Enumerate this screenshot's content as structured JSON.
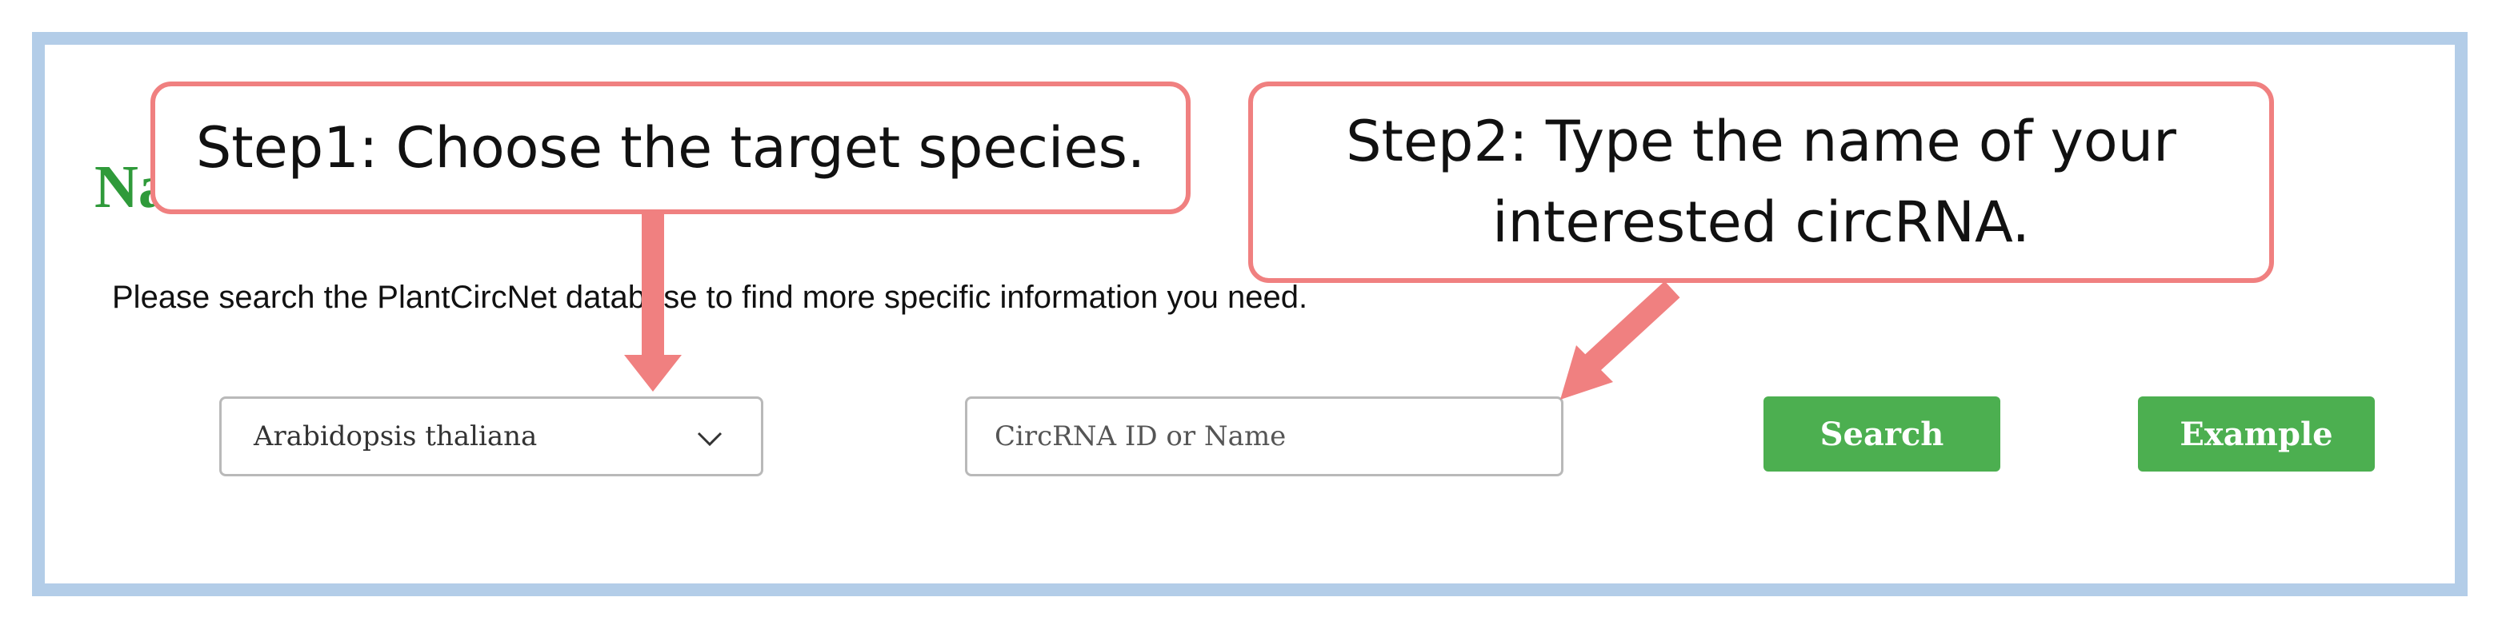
{
  "page": {
    "title": "Name Search",
    "intro": "Please search the PlantCircNet database to find more specific information you need."
  },
  "form": {
    "species_select": {
      "selected": "Arabidopsis thaliana",
      "icon": "chevron-down-icon"
    },
    "query_input": {
      "value": "",
      "placeholder": "CircRNA ID or Name"
    },
    "search_label": "Search",
    "example_label": "Example"
  },
  "annotations": {
    "step1": "Step1: Choose the target species.",
    "step2": "Step2: Type the name of your interested circRNA."
  },
  "colors": {
    "title_green": "#2f9a3a",
    "button_green": "#4caf50",
    "callout_border": "#f08080",
    "arrow": "#f08080",
    "frame_border": "#b3cde8"
  }
}
